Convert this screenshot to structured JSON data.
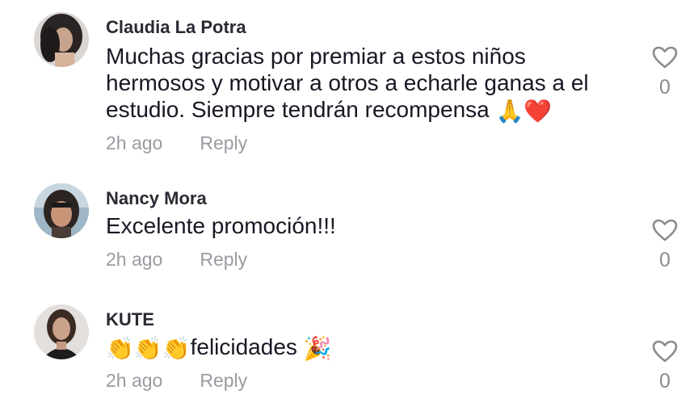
{
  "comments": [
    {
      "username": "Claudia La Potra",
      "text": "Muchas gracias por premiar a estos niños hermosos y motivar a otros a echarle ganas a el estudio. Siempre tendrán recompensa",
      "emojis": "🙏❤️",
      "time": "2h ago",
      "reply_label": "Reply",
      "likes": "0",
      "avatar_icon": "user-avatar-dark-hair"
    },
    {
      "username": "Nancy Mora",
      "text": "Excelente promoción!!!",
      "emojis": "",
      "time": "2h ago",
      "reply_label": "Reply",
      "likes": "0",
      "avatar_icon": "user-avatar-car-selfie"
    },
    {
      "username": "KUTE",
      "text_prefix_emojis": "👏👏👏",
      "text": "felicidades",
      "emojis": "🎉",
      "time": "2h ago",
      "reply_label": "Reply",
      "likes": "0",
      "avatar_icon": "user-avatar-woman-portrait"
    }
  ],
  "colors": {
    "text": "#161823",
    "username": "#2a2a33",
    "meta": "#9a9ba1",
    "heart_outline": "#8a8b91"
  }
}
